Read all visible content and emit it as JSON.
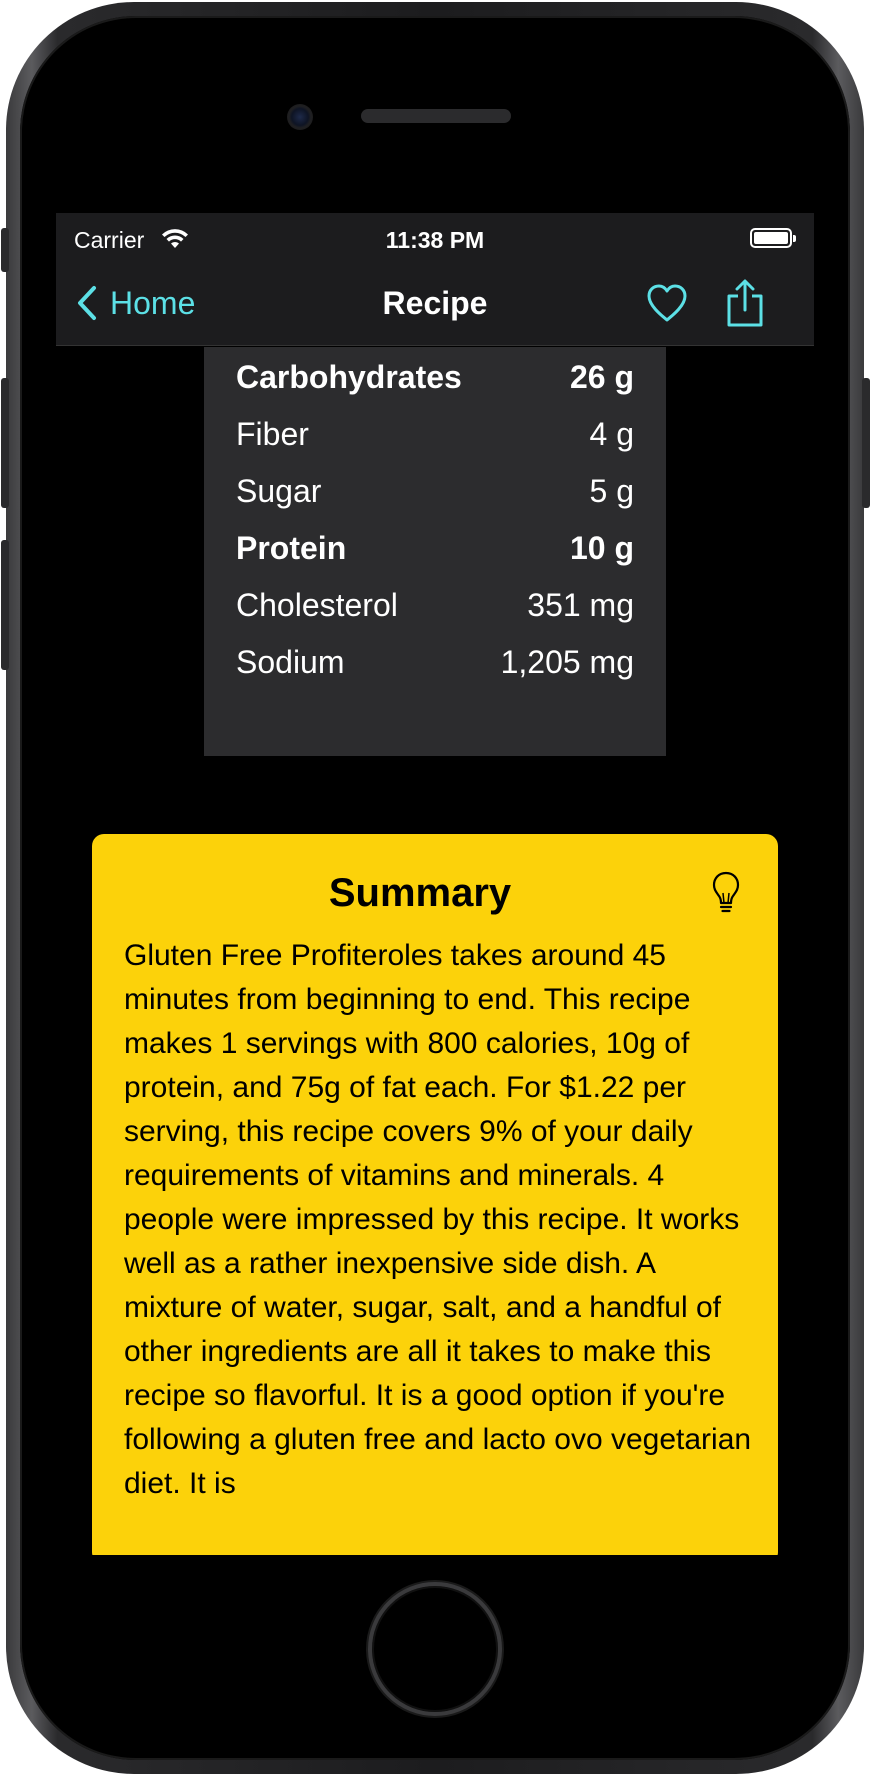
{
  "status_bar": {
    "carrier": "Carrier",
    "time": "11:38 PM"
  },
  "nav": {
    "back_label": "Home",
    "title": "Recipe"
  },
  "nutrition": {
    "rows": [
      {
        "label": "Carbohydrates",
        "value": "26 g"
      },
      {
        "label": "Fiber",
        "value": "4 g"
      },
      {
        "label": "Sugar",
        "value": "5 g"
      },
      {
        "label": "Protein",
        "value": "10 g"
      },
      {
        "label": "Cholesterol",
        "value": "351 mg"
      },
      {
        "label": "Sodium",
        "value": "1,205 mg"
      }
    ]
  },
  "summary": {
    "title": "Summary",
    "text": "Gluten Free Profiteroles takes around 45 minutes from beginning to end. This recipe makes 1 servings with 800 calories, 10g of protein, and 75g of fat each. For $1.22 per serving, this recipe covers 9% of your daily requirements of vitamins and minerals. 4 people were impressed by this recipe. It works well as a rather inexpensive side dish. A mixture of water, sugar, salt, and a handful of other ingredients are all it takes to make this recipe so flavorful. It is a good option if you're following a gluten free and lacto ovo vegetarian diet. It is"
  },
  "colors": {
    "accent": "#5ce0e6",
    "summary_bg": "#fcd20a",
    "table_bg": "#2c2c2e"
  },
  "icons": {
    "back": "chevron-left-icon",
    "favorite": "heart-icon",
    "share": "share-icon",
    "summary": "lightbulb-icon",
    "wifi": "wifi-icon",
    "battery": "battery-icon"
  }
}
